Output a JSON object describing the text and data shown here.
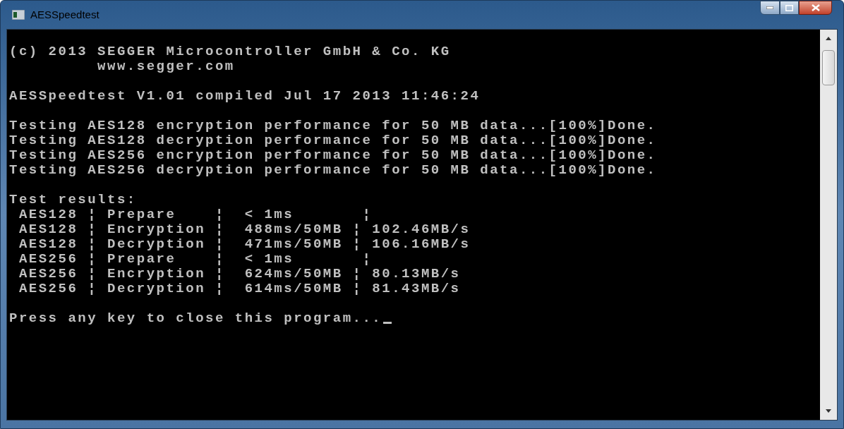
{
  "window": {
    "title": "AESSpeedtest"
  },
  "console": {
    "blocks": [
      [
        "(c) 2013 SEGGER Microcontroller GmbH & Co. KG",
        "         www.segger.com"
      ],
      [
        "AESSpeedtest V1.01 compiled Jul 17 2013 11:46:24"
      ],
      [
        "Testing AES128 encryption performance for 50 MB data...[100%]Done.",
        "Testing AES128 decryption performance for 50 MB data...[100%]Done.",
        "Testing AES256 encryption performance for 50 MB data...[100%]Done.",
        "Testing AES256 decryption performance for 50 MB data...[100%]Done."
      ],
      [
        "Test results:",
        " AES128 ¦ Prepare    ¦  < 1ms       ¦",
        " AES128 ¦ Encryption ¦  488ms/50MB ¦ 102.46MB/s",
        " AES128 ¦ Decryption ¦  471ms/50MB ¦ 106.16MB/s",
        " AES256 ¦ Prepare    ¦  < 1ms       ¦",
        " AES256 ¦ Encryption ¦  624ms/50MB ¦ 80.13MB/s",
        " AES256 ¦ Decryption ¦  614ms/50MB ¦ 81.43MB/s"
      ],
      [
        "Press any key to close this program..."
      ]
    ]
  }
}
